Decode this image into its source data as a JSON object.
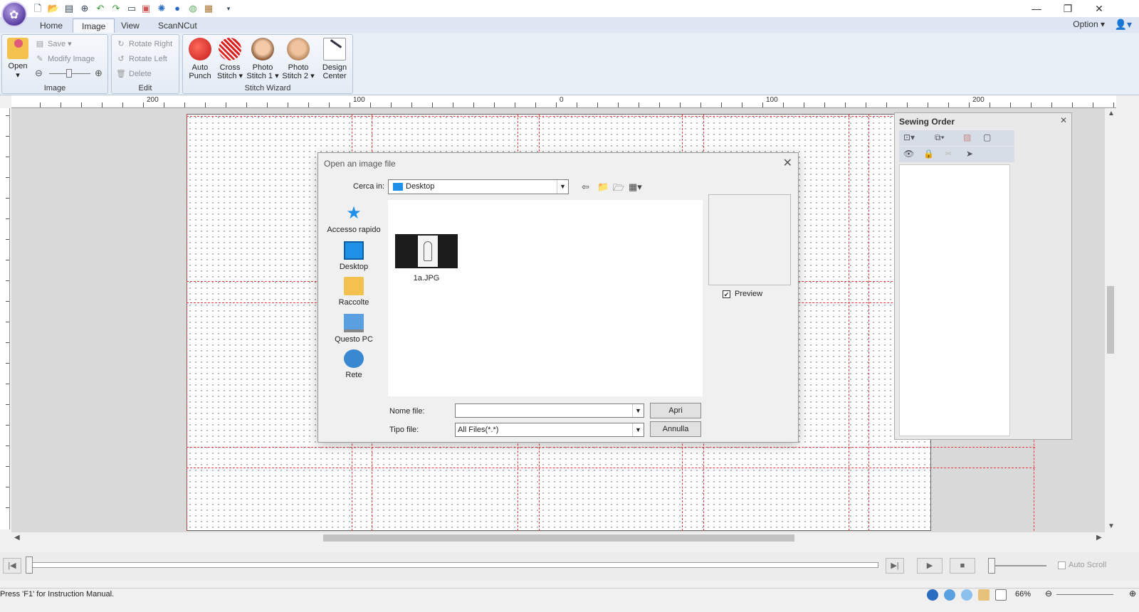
{
  "app": {
    "tabs": [
      "Home",
      "Image",
      "View",
      "ScanNCut"
    ],
    "option_label": "Option"
  },
  "ribbon": {
    "image_group": {
      "label": "Image",
      "open_label": "Open",
      "save_label": "Save",
      "modify_label": "Modify Image"
    },
    "edit_group": {
      "label": "Edit",
      "rotate_right_label": "Rotate Right",
      "rotate_left_label": "Rotate Left",
      "delete_label": "Delete"
    },
    "stitch_group": {
      "label": "Stitch Wizard",
      "buttons": [
        {
          "line1": "Auto",
          "line2": "Punch"
        },
        {
          "line1": "Cross",
          "line2": "Stitch ▾"
        },
        {
          "line1": "Photo",
          "line2": "Stitch 1 ▾"
        },
        {
          "line1": "Photo",
          "line2": "Stitch 2 ▾"
        },
        {
          "line1": "Design",
          "line2": "Center"
        }
      ]
    }
  },
  "ruler": {
    "labels": [
      "200",
      "100",
      "0",
      "100",
      "200"
    ]
  },
  "sewing_order": {
    "title": "Sewing Order"
  },
  "dialog": {
    "title": "Open an image file",
    "look_in_label": "Cerca in:",
    "look_in_value": "Desktop",
    "places": [
      "Accesso rapido",
      "Desktop",
      "Raccolte",
      "Questo PC",
      "Rete"
    ],
    "files": [
      {
        "name": "1a.JPG"
      }
    ],
    "preview_label": "Preview",
    "preview_checked": true,
    "file_name_label": "Nome file:",
    "file_name_value": "",
    "file_type_label": "Tipo file:",
    "file_type_value": "All Files(*.*)",
    "open_button": "Apri",
    "cancel_button": "Annulla"
  },
  "transport": {
    "auto_scroll_label": "Auto Scroll"
  },
  "statusbar": {
    "text": "Press 'F1' for Instruction Manual.",
    "zoom": "66%"
  },
  "colors": {
    "accent": "#2a6cc0",
    "grid_line": "#e23b3b",
    "ribbon_bg": "#e8eef6"
  }
}
